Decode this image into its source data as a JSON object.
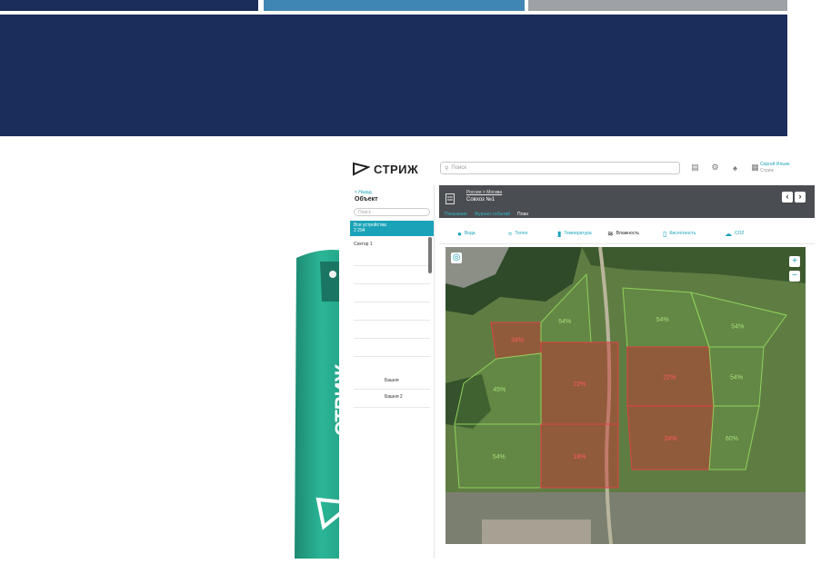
{
  "brand": {
    "name": "СТРИЖ"
  },
  "colors": {
    "navy": "#1b2d5a",
    "teal": "#1aa3b8",
    "device_green": "#25a38a",
    "dry_field": "#cc3333",
    "normal_field": "#7dc24a"
  },
  "topbar": {
    "search_placeholder": "Поиск",
    "icons": [
      "document-icon",
      "settings-icon",
      "bell-icon",
      "apps-grid-icon"
    ],
    "user_name": "Сергей Ильин",
    "user_org": "Стриж"
  },
  "sidebar": {
    "back_label": "< Назад",
    "title": "Объект",
    "search_placeholder": "Поиск",
    "active_item": {
      "label": "Все устройства",
      "count": "2 294"
    },
    "items": [
      "Сектор 1",
      "Башня",
      "Башня 2"
    ]
  },
  "header": {
    "breadcrumb": "Россия > Москва",
    "site_name": "Совхоз №1",
    "tabs": [
      "Показания",
      "Журнал событий",
      "План"
    ],
    "active_tab": "План"
  },
  "metrics": [
    {
      "label": "Вода",
      "icon": "water-drop-icon"
    },
    {
      "label": "Тепло",
      "icon": "heat-icon"
    },
    {
      "label": "Температура",
      "icon": "thermometer-icon"
    },
    {
      "label": "Влажность",
      "icon": "humidity-icon"
    },
    {
      "label": "Кислотность",
      "icon": "acidity-icon"
    },
    {
      "label": "CO2",
      "icon": "cloud-icon"
    }
  ],
  "active_metric": "Влажность",
  "fields": [
    {
      "label": "34%",
      "status": "dry"
    },
    {
      "label": "54%",
      "status": "normal"
    },
    {
      "label": "22%",
      "status": "dry"
    },
    {
      "label": "45%",
      "status": "normal"
    },
    {
      "label": "54%",
      "status": "normal"
    },
    {
      "label": "18%",
      "status": "dry"
    },
    {
      "label": "54%",
      "status": "normal"
    },
    {
      "label": "54%",
      "status": "normal"
    },
    {
      "label": "22%",
      "status": "dry"
    },
    {
      "label": "54%",
      "status": "normal"
    },
    {
      "label": "24%",
      "status": "dry"
    },
    {
      "label": "60%",
      "status": "normal"
    }
  ]
}
